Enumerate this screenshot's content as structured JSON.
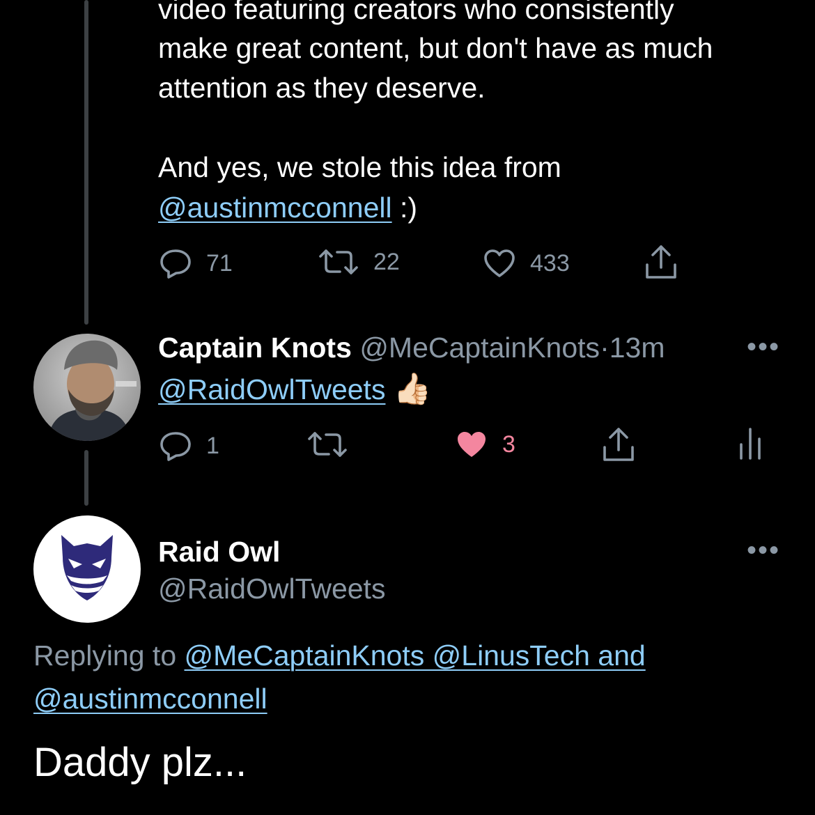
{
  "tweet1": {
    "lines": [
      "video featuring creators who consistently",
      "make great content, but don't have as much",
      "attention as they deserve."
    ],
    "line4": "And yes, we stole this idea from",
    "mention": "@austinmcconnell",
    "after_mention": " :)",
    "replies": "71",
    "retweets": "22",
    "likes": "433"
  },
  "tweet2": {
    "name": "Captain Knots",
    "handle": "@MeCaptainKnots",
    "sep": "·",
    "time": "13m",
    "mention": "@RaidOwlTweets",
    "emoji": "👍🏻",
    "replies": "1",
    "likes": "3"
  },
  "tweet3": {
    "name": "Raid Owl",
    "handle": "@RaidOwlTweets",
    "replying_prefix": "Replying to ",
    "replying_links": "@MeCaptainKnots @LinusTech and",
    "replying_line2": "@austinmcconnell",
    "text": "Daddy plz..."
  },
  "colors": {
    "background": "#000000",
    "link": "#8ecdf8",
    "secondary": "#8b98a5",
    "like_active": "#f4869f",
    "owl_brand": "#2e2a7a"
  },
  "icons": [
    "reply-icon",
    "retweet-icon",
    "like-icon",
    "share-icon",
    "analytics-icon",
    "more-icon"
  ]
}
